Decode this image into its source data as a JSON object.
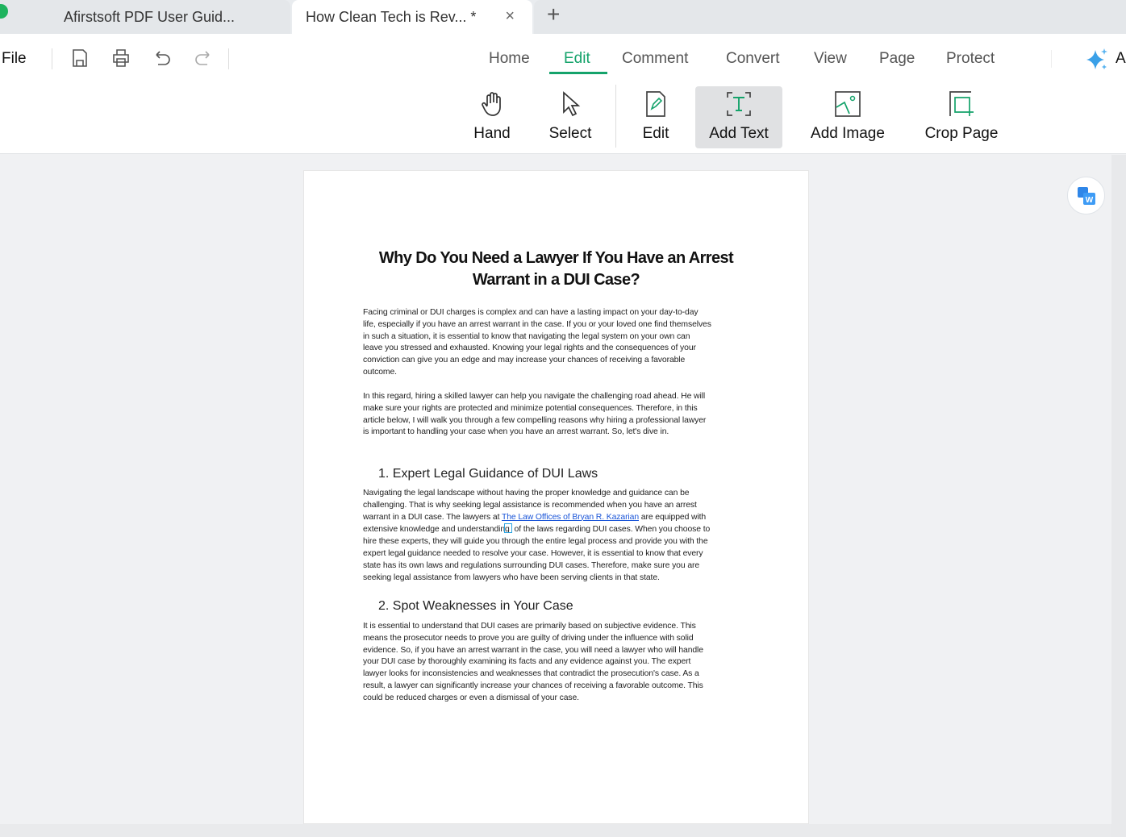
{
  "tabs": [
    {
      "label": "Afirstsoft PDF User Guid..."
    },
    {
      "label": "How Clean Tech is Rev... *",
      "close": "×"
    }
  ],
  "new_tab": "+",
  "quick": {
    "file": "File"
  },
  "menu": [
    "Home",
    "Edit",
    "Comment",
    "Convert",
    "View",
    "Page",
    "Protect"
  ],
  "menu_active": "Edit",
  "ai_label": "A",
  "tools": [
    "Hand",
    "Select",
    "Edit",
    "Add Text",
    "Add Image",
    "Crop Page"
  ],
  "tool_selected": "Add Text",
  "colors": {
    "accent": "#15a36b",
    "link": "#1a55d8"
  },
  "document": {
    "title": [
      "Why Do You Need a Lawyer If You Have an Arrest",
      "Warrant in a DUI Case?"
    ],
    "p1": [
      "Facing criminal or DUI charges is complex and can have a lasting impact on your day-to-day",
      "life, especially if you have an arrest warrant in the case. If you or your loved one find themselves",
      "in such a situation, it is essential to know that navigating the legal system on your own can",
      "leave you stressed and exhausted. Knowing your legal rights and the consequences of your",
      "conviction can give you an edge and may increase your chances of receiving a favorable",
      "outcome."
    ],
    "p2": [
      "In this regard, hiring a skilled lawyer can help you navigate the challenging road ahead. He will",
      "make sure your rights are protected and minimize potential consequences. Therefore, in this",
      "article below, I will walk you through a few compelling reasons why hiring a professional lawyer",
      "is important to handling your case when you have an arrest warrant. So, let's dive in."
    ],
    "h1": "1. Expert Legal Guidance of DUI Laws",
    "p3a": [
      "Navigating the legal landscape without having the proper knowledge and guidance can be",
      "challenging. That is why seeking legal assistance is recommended when you have an arrest"
    ],
    "p3_link_pre": "warrant in a DUI case. The lawyers at ",
    "p3_link": "The Law Offices of Bryan R. Kazarian",
    "p3_link_post": " are equipped with",
    "p3_caret_pre": "extensive knowledge and understanding",
    "p3_caret_post": " of the laws regarding DUI cases. When you choose to",
    "p3b": [
      "hire these experts, they will guide you through the entire legal process and provide you with the",
      "expert legal guidance needed to resolve your case. However, it is essential to know that every",
      "state has its own laws and regulations surrounding DUI cases. Therefore, make sure you are",
      "seeking legal assistance from lawyers who have been serving clients in that state."
    ],
    "h2": "2. Spot Weaknesses in Your Case",
    "p4": [
      "It is essential to understand that DUI cases are primarily based on subjective evidence. This",
      "means the prosecutor needs to prove you are guilty of driving under the influence with solid",
      "evidence. So, if you have an arrest warrant in the case, you will need a lawyer who will handle",
      "your DUI case by thoroughly examining its facts and any evidence against you. The expert",
      "lawyer looks for inconsistencies and weaknesses that contradict the prosecution's case. As a",
      "result, a lawyer can significantly increase your chances of receiving a favorable outcome. This",
      "could be reduced charges or even a dismissal of your case."
    ]
  }
}
